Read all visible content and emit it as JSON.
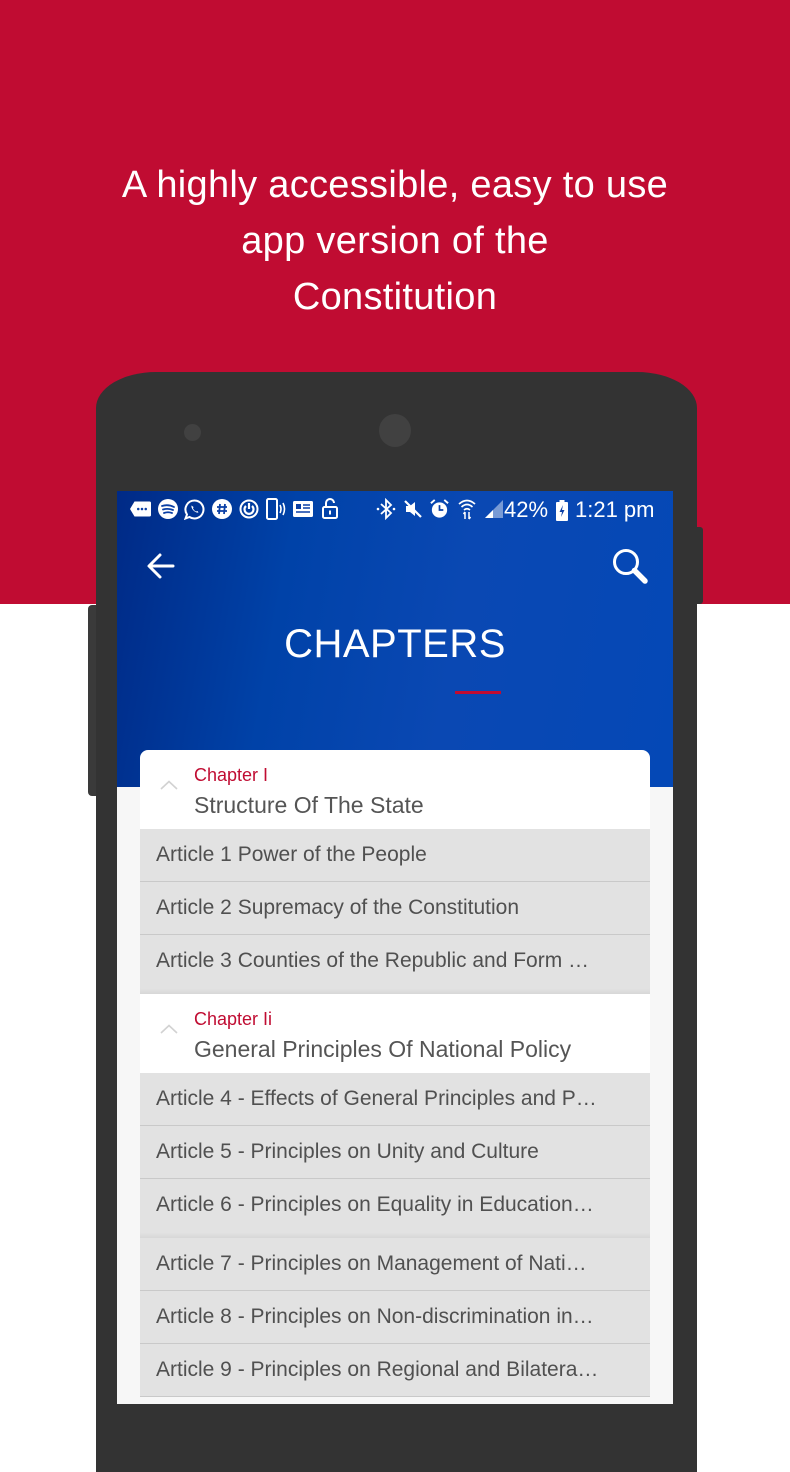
{
  "promo": {
    "headline_lines": [
      "A highly accessible, easy to use",
      "app version of the",
      "Constitution"
    ],
    "brand_color": "#c00c32"
  },
  "status_bar": {
    "left_icons": [
      "messages-icon",
      "spotify-icon",
      "whatsapp-icon",
      "slack-icon",
      "sync-icon",
      "phone-vibrate-icon",
      "news-icon",
      "lock-icon"
    ],
    "right_icons": [
      "bluetooth-icon",
      "mute-icon",
      "alarm-icon",
      "wifi-icon",
      "signal-icon",
      "battery-charging-icon"
    ],
    "battery": "42%",
    "time": "1:21 pm"
  },
  "app": {
    "title": "CHAPTERS",
    "back_icon": "arrow-left-icon",
    "search_icon": "search-icon",
    "header_color": "#0042a8",
    "accent_color": "#c00c32"
  },
  "chapters": [
    {
      "number": "Chapter I",
      "title": "Structure Of The State",
      "expanded": true,
      "articles": [
        "Article 1 Power of the People",
        "Article 2 Supremacy of the Constitution",
        "Article 3 Counties of the Republic and Form …"
      ]
    },
    {
      "number": "Chapter Ii",
      "title": "General Principles Of National Policy",
      "expanded": true,
      "articles": [
        "Article 4 - Effects of General Principles and P…",
        "Article 5 - Principles on Unity and Culture",
        "Article 6 - Principles on Equality in Education…",
        "Article 7 - Principles on Management of Nati…",
        "Article 8 - Principles on Non-discrimination in…",
        "Article 9 - Principles on Regional and Bilatera…"
      ]
    }
  ]
}
